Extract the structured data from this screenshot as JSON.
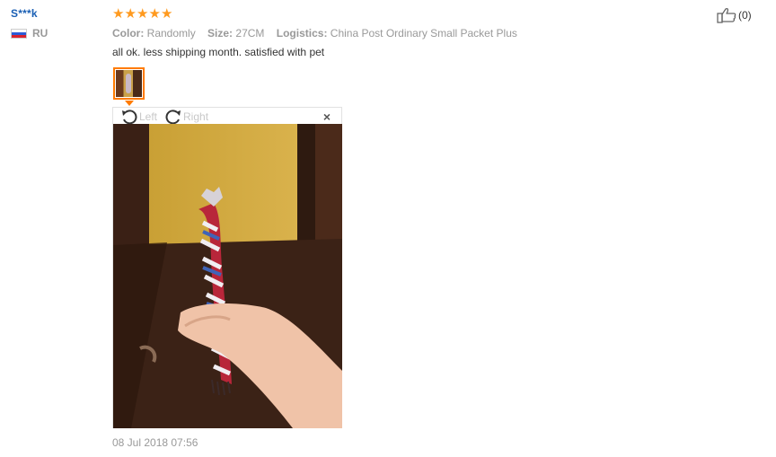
{
  "reviewer": {
    "name": "S***k",
    "country": "RU"
  },
  "review": {
    "stars": "★★★★★",
    "attributes": [
      {
        "label": "Color:",
        "value": "Randomly"
      },
      {
        "label": "Size:",
        "value": "27CM"
      },
      {
        "label": "Logistics:",
        "value": "China Post Ordinary Small Packet Plus"
      }
    ],
    "feedback": "all ok. less shipping month. satisfied with pet",
    "date": "08 Jul 2018 07:56"
  },
  "viewer": {
    "rotate_left": "Left",
    "rotate_right": "Right",
    "close": "×"
  },
  "helpful": {
    "count": "(0)"
  },
  "icons": {
    "thumbs_up": "thumbs-up-icon",
    "rotate_left": "rotate-left-icon",
    "rotate_right": "rotate-right-icon",
    "close": "close-icon",
    "flag": "russia-flag-icon",
    "star": "star-icon"
  },
  "colors": {
    "name_blue": "#1a5fb4",
    "star_orange": "#ff9a1f",
    "thumb_border": "#ff7b00"
  }
}
